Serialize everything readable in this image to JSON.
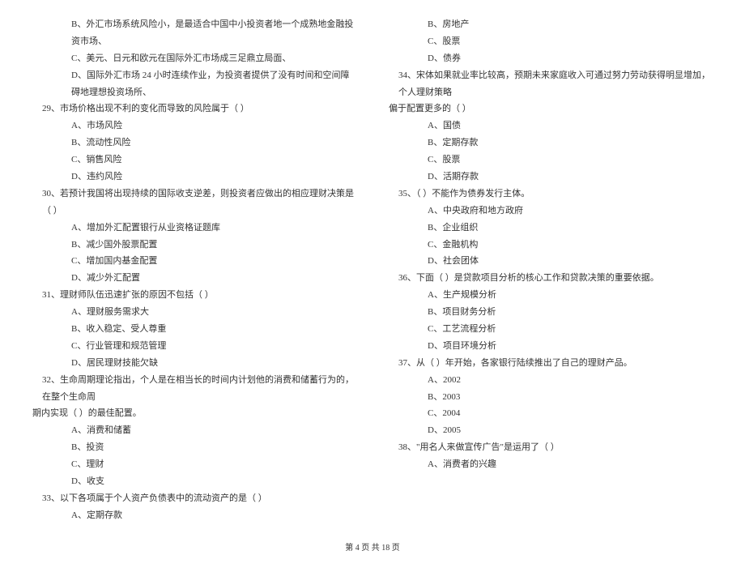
{
  "left": {
    "opt_b_28": "B、外汇市场系统风险小，是最适合中国中小投资者地一个成熟地金融投资市场、",
    "opt_c_28": "C、美元、日元和欧元在国际外汇市场成三足鼎立局面、",
    "opt_d_28": "D、国际外汇市场 24 小时连续作业，为投资者提供了没有时间和空间障碍地理想投资场所、",
    "q29": "29、市场价格出现不利的变化而导致的风险属于（    ）",
    "q29_a": "A、市场风险",
    "q29_b": "B、流动性风险",
    "q29_c": "C、销售风险",
    "q29_d": "D、违约风险",
    "q30": "30、若预计我国将出现持续的国际收支逆差，则投资者应做出的相应理财决策是（    ）",
    "q30_a": "A、增加外汇配置银行从业资格证题库",
    "q30_b": "B、减少国外股票配置",
    "q30_c": "C、增加国内基金配置",
    "q30_d": "D、减少外汇配置",
    "q31": "31、理财师队伍迅速扩张的原因不包括（    ）",
    "q31_a": "A、理财服务需求大",
    "q31_b": "B、收入稳定、受人尊重",
    "q31_c": "C、行业管理和规范管理",
    "q31_d": "D、居民理财技能欠缺",
    "q32_l1": "32、生命周期理论指出，个人是在相当长的时间内计划他的消费和储蓄行为的，在整个生命周",
    "q32_l2": "期内实现（    ）的最佳配置。",
    "q32_a": "A、消费和储蓄",
    "q32_b": "B、投资",
    "q32_c": "C、理财",
    "q32_d": "D、收支",
    "q33": "33、以下各项属于个人资产负债表中的流动资产的是（    ）",
    "q33_a": "A、定期存款"
  },
  "right": {
    "q33_b": "B、房地产",
    "q33_c": "C、股票",
    "q33_d": "D、债券",
    "q34_l1": "34、宋体如果就业率比较高，预期未来家庭收入可通过努力劳动获得明显增加，个人理财策略",
    "q34_l2": "偏于配置更多的（    ）",
    "q34_a": "A、国债",
    "q34_b": "B、定期存款",
    "q34_c": "C、股票",
    "q34_d": "D、活期存款",
    "q35": "35、（    ）不能作为债券发行主体。",
    "q35_a": "A、中央政府和地方政府",
    "q35_b": "B、企业组织",
    "q35_c": "C、金融机构",
    "q35_d": "D、社会团体",
    "q36": "36、下面（    ）是贷款项目分析的核心工作和贷款决策的重要依据。",
    "q36_a": "A、生产规模分析",
    "q36_b": "B、项目财务分析",
    "q36_c": "C、工艺流程分析",
    "q36_d": "D、项目环境分析",
    "q37": "37、从（    ）年开始，各家银行陆续推出了自己的理财产品。",
    "q37_a": "A、2002",
    "q37_b": "B、2003",
    "q37_c": "C、2004",
    "q37_d": "D、2005",
    "q38": "38、\"用名人来做宣传广告\"是运用了（    ）",
    "q38_a": "A、消费者的兴趣"
  },
  "footer": "第 4 页 共 18 页"
}
